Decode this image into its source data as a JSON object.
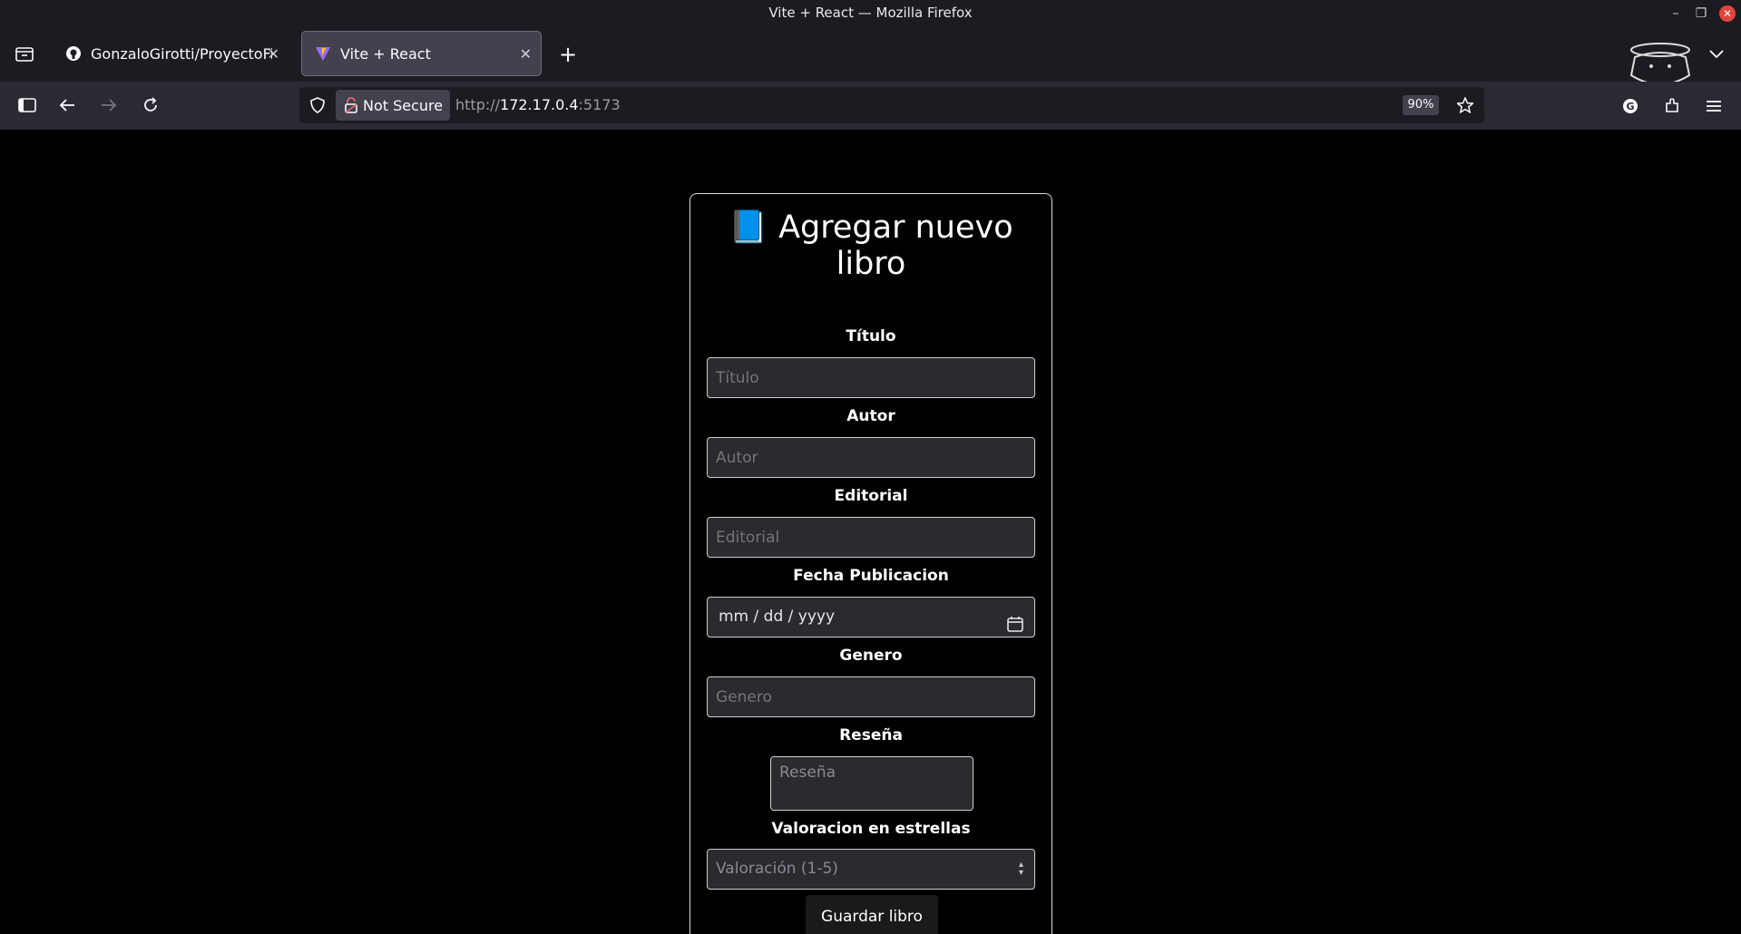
{
  "window": {
    "title": "Vite + React — Mozilla Firefox"
  },
  "tabs": [
    {
      "label": "GonzaloGirotti/ProyectoFin",
      "icon": "github-icon"
    },
    {
      "label": "Vite + React",
      "icon": "vite-icon"
    }
  ],
  "navbar": {
    "security_label": "Not Secure",
    "url_prefix": "http://",
    "url_host": "172.17.0.4",
    "url_port": ":5173",
    "zoom": "90%"
  },
  "form": {
    "title": "Agregar nuevo libro",
    "title_icon": "📘",
    "fields": [
      {
        "label": "Título",
        "placeholder": "Título"
      },
      {
        "label": "Autor",
        "placeholder": "Autor"
      },
      {
        "label": "Editorial",
        "placeholder": "Editorial"
      },
      {
        "label": "Fecha Publicacion",
        "placeholder": "mm / dd / yyyy"
      },
      {
        "label": "Genero",
        "placeholder": "Genero"
      },
      {
        "label": "Reseña",
        "placeholder": "Reseña"
      },
      {
        "label": "Valoracion en estrellas",
        "placeholder": "Valoración (1-5)"
      }
    ],
    "submit_label": "Guardar libro"
  },
  "colors": {
    "accent_close": "#e0453a",
    "card_border": "#d9d9d9"
  }
}
